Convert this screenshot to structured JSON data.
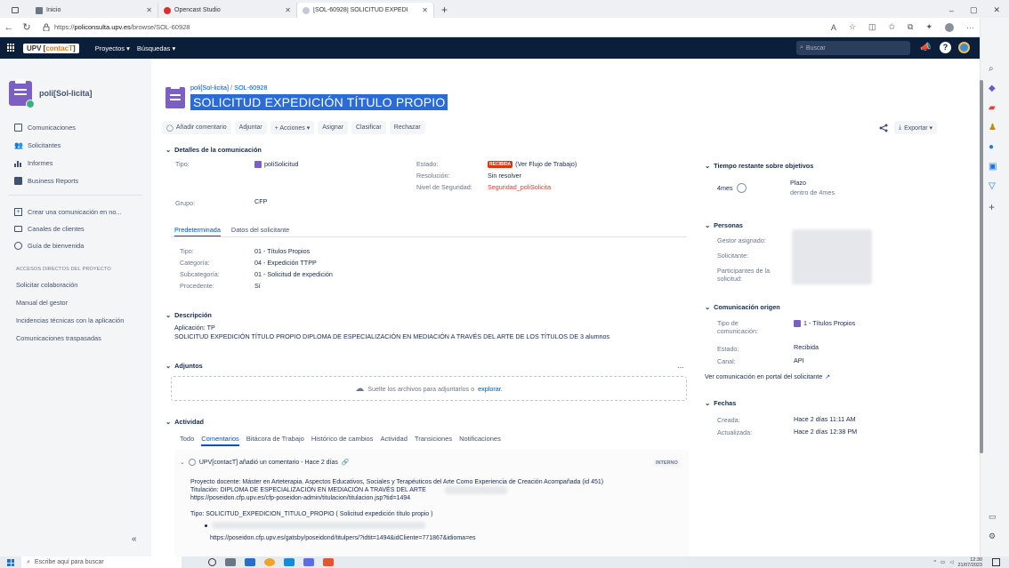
{
  "browser": {
    "tabs": [
      {
        "label": "Inicio"
      },
      {
        "label": "Opencast Studio"
      },
      {
        "label": "[SOL-60928] SOLICITUD EXPEDI"
      }
    ],
    "new_tab": "+",
    "url_prefix": "https://",
    "url_host": "policonsulta.upv.es",
    "url_path": "/browse/SOL-60928"
  },
  "appbar": {
    "logo_left": "UPV",
    "logo_right": "contacT",
    "nav": [
      "Proyectos ▾",
      "Búsquedas ▾"
    ],
    "search_placeholder": "Buscar"
  },
  "sidebar": {
    "project_name": "poli[Sol-licita]",
    "items": [
      {
        "label": "Comunicaciones",
        "icon": "list-icon"
      },
      {
        "label": "Solicitantes",
        "icon": "people-icon"
      },
      {
        "label": "Informes",
        "icon": "chart-icon"
      },
      {
        "label": "Business Reports",
        "icon": "report-icon"
      }
    ],
    "actions": [
      {
        "label": "Crear una comunicación en no...",
        "icon": "create-icon"
      },
      {
        "label": "Canales de clientes",
        "icon": "monitor-icon"
      },
      {
        "label": "Guía de bienvenida",
        "icon": "compass-icon"
      }
    ],
    "shortcuts_heading": "ACCESOS DIRECTOS DEL PROYECTO",
    "shortcuts": [
      "Solicitar colaboración",
      "Manual del gestor",
      "Incidencias técnicas con la aplicación",
      "Comunicaciones traspasadas"
    ],
    "collapse": "«"
  },
  "issue": {
    "breadcrumb_project": "poli[Sol-licita]",
    "breadcrumb_sep": "/",
    "breadcrumb_key": "SOL-60928",
    "title": "SOLICITUD EXPEDICIÓN TÍTULO PROPIO",
    "toolbar": [
      "Añadir comentario",
      "Adjuntar",
      "+ Acciones ▾",
      "Asignar",
      "Clasificar",
      "Rechazar"
    ],
    "export_label": "Exportar ▾"
  },
  "details": {
    "heading": "Detalles de la comunicación",
    "tipo_label": "Tipo:",
    "tipo_value": "poliSolicitud",
    "grupo_label": "Grupo:",
    "grupo_value": "CFP",
    "estado_label": "Estado:",
    "estado_badge": "RECIBIDA",
    "estado_link": "(Ver Flujo de Trabajo)",
    "resolucion_label": "Resolución:",
    "resolucion_value": "Sin resolver",
    "nivel_label": "Nivel de Seguridad:",
    "nivel_value": "Seguridad_poliSolicita"
  },
  "subtabs": {
    "items": [
      "Predeterminada",
      "Datos del solicitante"
    ],
    "fields": [
      {
        "label": "Tipo:",
        "value": "01 - Títulos Propios"
      },
      {
        "label": "Categoría:",
        "value": "04 - Expedición TTPP"
      },
      {
        "label": "Subcategoría:",
        "value": "01 - Solicitud de expedición"
      },
      {
        "label": "Procedente:",
        "value": "Sí"
      }
    ]
  },
  "description": {
    "heading": "Descripción",
    "line1": "Aplicación: TP",
    "line2": "SOLICITUD EXPEDICIÓN TÍTULO PROPIO DIPLOMA DE ESPECIALIZACIÓN EN MEDIACIÓN A TRAVÉS DEL ARTE DE LOS TÍTULOS DE 3 alumnos"
  },
  "attachments": {
    "heading": "Adjuntos",
    "more": "...",
    "drop_text": "Suelte los archivos para adjuntarlos o",
    "drop_link": "explorar."
  },
  "activity": {
    "heading": "Actividad",
    "tabs": [
      "Todo",
      "Comentarios",
      "Bitácora de Trabajo",
      "Histórico de cambios",
      "Actividad",
      "Transiciones",
      "Notificaciones"
    ],
    "comment_header": "UPV[contacT] añadió un comentario - Hace 2 días",
    "comment_badge": "INTERNO",
    "comment_lines": [
      "Proyecto docente: Máster en Arteterapia. Aspectos Educativos, Sociales y Terapéuticos del Arte Como Experiencia de Creación Acompañada (id 451)",
      "Titulación: DIPLOMA DE ESPECIALIZACIÓN EN MEDIACIÓN A TRAVÉS DEL ARTE",
      "https://poseidon.cfp.upv.es/cfp-poseidon-admin/titulacion/titulacion.jsp?tid=1494",
      "Tipo: SOLICITUD_EXPEDICION_TITULO_PROPIO ( Solicitud expedición título propio )",
      "https://poseidon.cfp.upv.es/gatsby/poseidond/titulpers/?idtit=1494&idCliente=771867&idioma=es"
    ]
  },
  "right_panel": {
    "time_heading": "Tiempo restante sobre objetivos",
    "time_value": "4mes",
    "plazo_label": "Plazo",
    "plazo_value": "dentro de 4mes",
    "people_heading": "Personas",
    "gestor_label": "Gestor asignado:",
    "solicitante_label": "Solicitante:",
    "participantes_label": "Participantes de la solicitud:",
    "origin_heading": "Comunicación origen",
    "tipo_com_label": "Tipo de comunicación:",
    "tipo_com_value": "1 - Títulos Propios",
    "estado_label": "Estado:",
    "estado_value": "Recibida",
    "canal_label": "Canal:",
    "canal_value": "API",
    "portal_link": "Ver comunicación en portal del solicitante",
    "fechas_heading": "Fechas",
    "creada_label": "Creada:",
    "creada_value": "Hace 2 días 11:11 AM",
    "actualizada_label": "Actualizada:",
    "actualizada_value": "Hace 2 días 12:38 PM"
  },
  "taskbar": {
    "search_placeholder": "Escribe aquí para buscar",
    "time": "12:30",
    "date": "21/07/2023"
  },
  "colors": {
    "app_bar": "#0b1f3a",
    "accent": "#0052cc",
    "project_purple": "#7b5fc2",
    "title_highlight": "#2c6bd6",
    "badge_red": "#de350b"
  }
}
